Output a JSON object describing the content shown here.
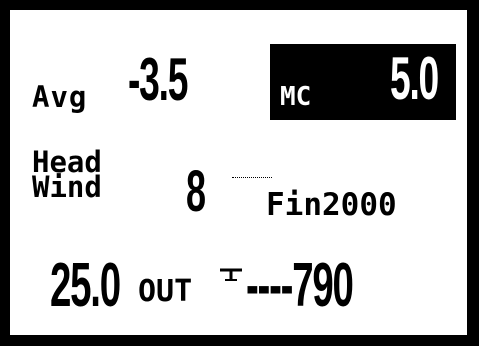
{
  "display": {
    "avg_label": "Avg",
    "avg_value": "-3.5",
    "mc_label": "MC",
    "mc_value": "5.0",
    "headwind_label_line1": "Head",
    "headwind_label_line2": "Wind",
    "headwind_value": "8",
    "fin_label": "Fin2000",
    "distance_value": "25.0",
    "distance_label": "OUT",
    "altitude_value": "----790"
  },
  "icons": {
    "arrow": "altitude-arrow-icon"
  }
}
